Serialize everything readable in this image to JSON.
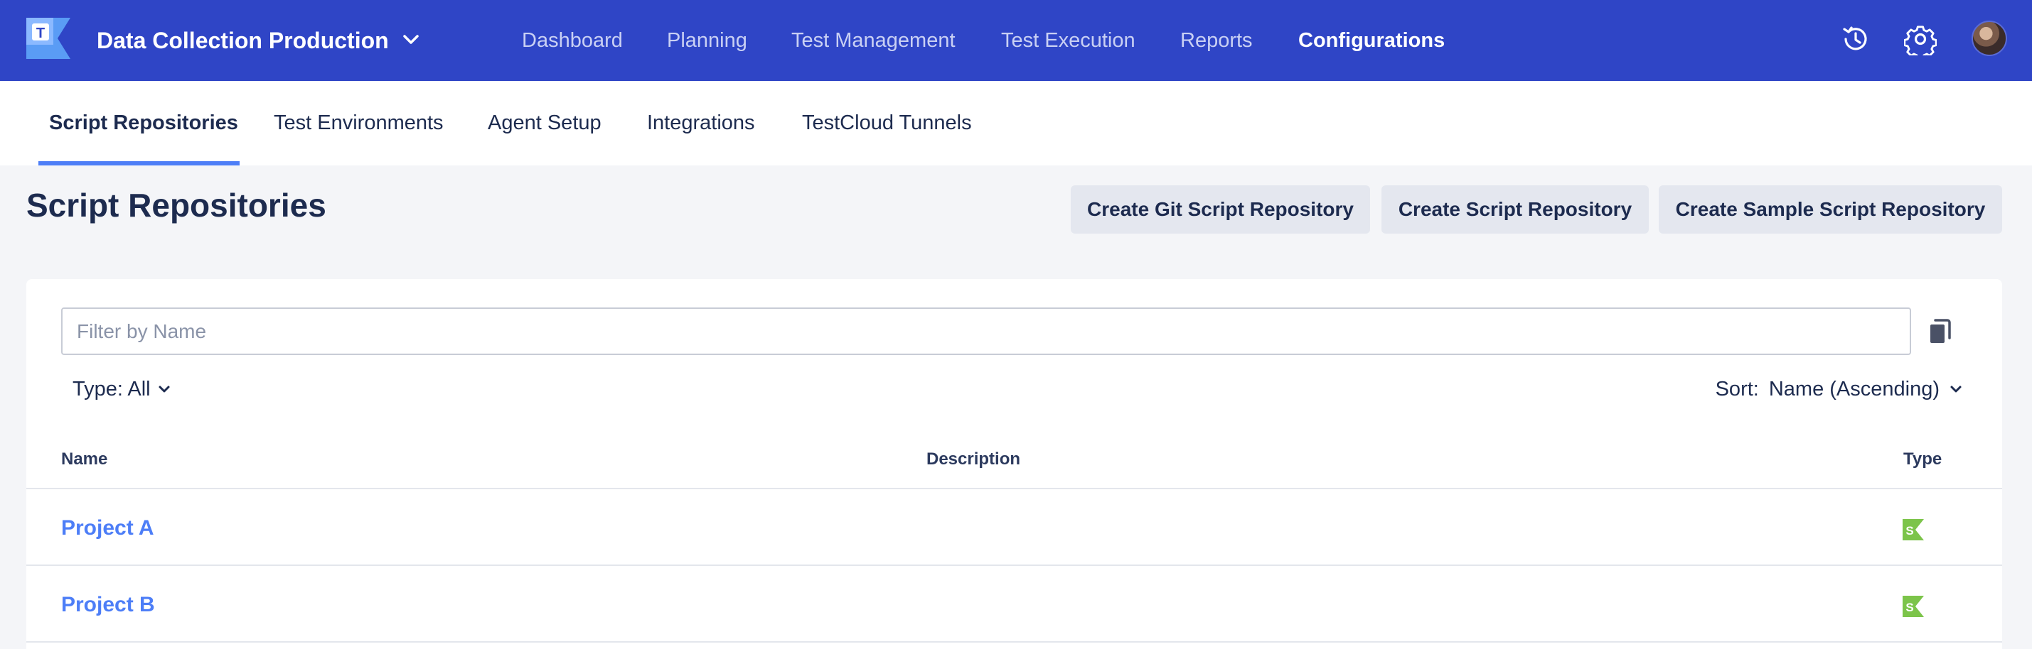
{
  "header": {
    "project_name": "Data Collection Production",
    "nav": [
      {
        "label": "Dashboard",
        "active": false
      },
      {
        "label": "Planning",
        "active": false
      },
      {
        "label": "Test Management",
        "active": false
      },
      {
        "label": "Test Execution",
        "active": false
      },
      {
        "label": "Reports",
        "active": false
      },
      {
        "label": "Configurations",
        "active": true
      }
    ],
    "icons": [
      "history-icon",
      "gear-icon",
      "user-avatar"
    ]
  },
  "subnav": {
    "tabs": [
      {
        "label": "Script Repositories",
        "active": true
      },
      {
        "label": "Test Environments",
        "active": false
      },
      {
        "label": "Agent Setup",
        "active": false
      },
      {
        "label": "Integrations",
        "active": false
      },
      {
        "label": "TestCloud Tunnels",
        "active": false
      }
    ]
  },
  "page": {
    "title": "Script Repositories",
    "actions": [
      "Create Git Script Repository",
      "Create Script Repository",
      "Create Sample Script Repository"
    ]
  },
  "filters": {
    "search_placeholder": "Filter by Name",
    "search_value": "",
    "type_label": "Type: All",
    "sort_prefix": "Sort:",
    "sort_value": "Name (Ascending)"
  },
  "table": {
    "columns": [
      "Name",
      "Description",
      "Type"
    ],
    "rows": [
      {
        "name": "Project A",
        "description": "",
        "type": "katalon-studio-icon"
      },
      {
        "name": "Project B",
        "description": "",
        "type": "katalon-studio-icon"
      }
    ]
  },
  "colors": {
    "header_bg": "#2f45c6",
    "accent": "#4d7ef7",
    "badge_green": "#7cc44a"
  }
}
